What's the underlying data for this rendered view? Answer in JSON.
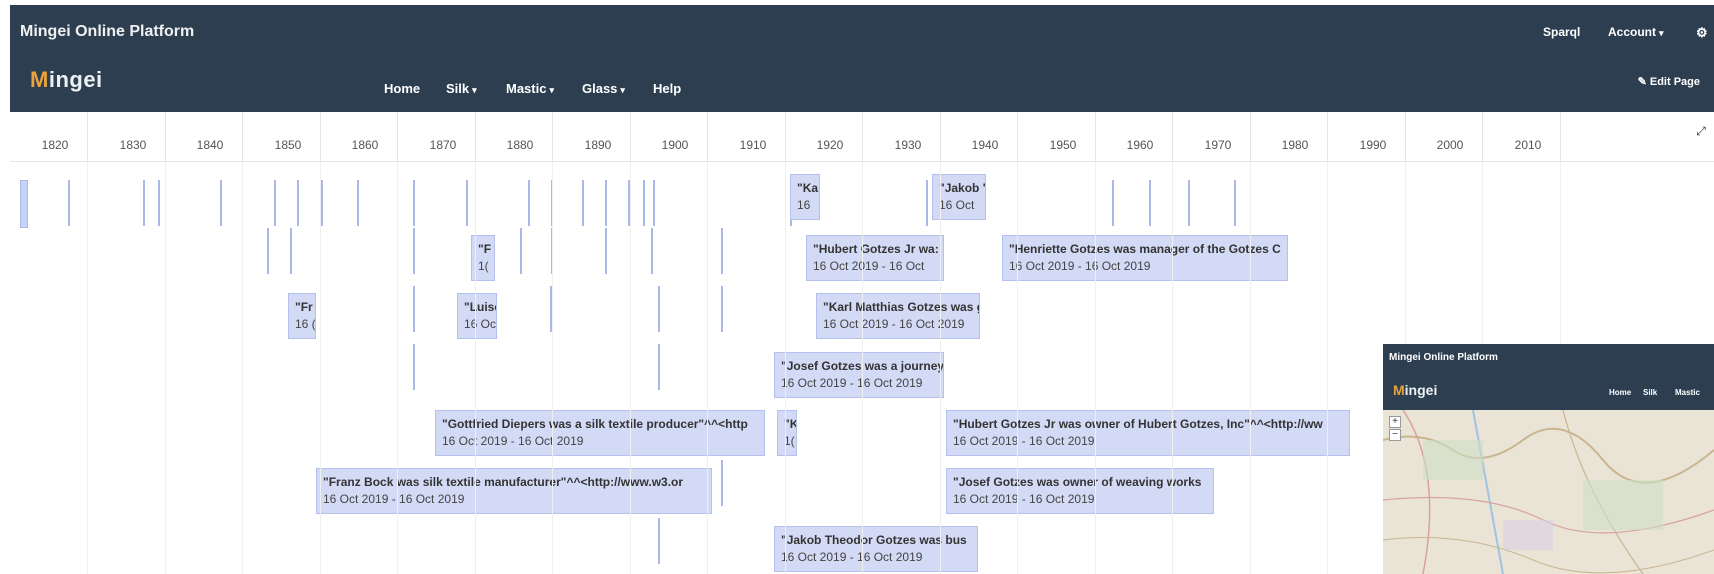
{
  "header": {
    "title": "Mingei Online Platform",
    "logo_initial": "M",
    "logo_rest": "ingei",
    "sparql": "Sparql",
    "account": "Account",
    "settings_icon": "gear-icon",
    "nav": [
      {
        "label": "Home",
        "dropdown": false
      },
      {
        "label": "Silk",
        "dropdown": true
      },
      {
        "label": "Mastic",
        "dropdown": true
      },
      {
        "label": "Glass",
        "dropdown": true
      },
      {
        "label": "Help",
        "dropdown": false
      }
    ],
    "edit_page": "Edit Page",
    "edit_icon": "pencil-icon"
  },
  "timeline": {
    "years": [
      "1820",
      "1830",
      "1840",
      "1850",
      "1860",
      "1870",
      "1880",
      "1890",
      "1900",
      "1910",
      "1920",
      "1930",
      "1940",
      "1950",
      "1960",
      "1970",
      "1980",
      "1990",
      "2000",
      "2010"
    ],
    "expand_icon": "expand-icon",
    "events": [
      {
        "title": "\"Ka",
        "date": "16"
      },
      {
        "title": "\"Jakob '",
        "date": "16 Oct"
      },
      {
        "title": "\"F",
        "date": "1("
      },
      {
        "title": "\"Hubert Gotzes Jr wa:",
        "date": "16 Oct 2019 - 16 Oct"
      },
      {
        "title": "\"Henriette Gotzes was manager of the Gotzes C",
        "date": "16 Oct 2019 - 16 Oct 2019"
      },
      {
        "title": "\"Fr",
        "date": "16 ("
      },
      {
        "title": "\"Luise",
        "date": "16 Oc"
      },
      {
        "title": "\"Karl Matthias Gotzes was gro",
        "date": "16 Oct 2019 - 16 Oct 2019"
      },
      {
        "title": "\"Josef Gotzes was a journey",
        "date": "16 Oct 2019 - 16 Oct 2019"
      },
      {
        "title": "\"Gottfried Diepers was a silk textile producer\"^^<http",
        "date": "16 Oct 2019 - 16 Oct 2019"
      },
      {
        "title": "\"K",
        "date": "1("
      },
      {
        "title": "\"Hubert Gotzes Jr was owner of Hubert Gotzes, Inc\"^^<http://ww",
        "date": "16 Oct 2019 - 16 Oct 2019"
      },
      {
        "title": "\"Franz Bock was silk textile manufacturer\"^^<http://www.w3.or",
        "date": "16 Oct 2019 - 16 Oct 2019"
      },
      {
        "title": "\"Josef Gotzes was owner of weaving works",
        "date": "16 Oct 2019 - 16 Oct 2019"
      },
      {
        "title": "\"Jakob Theodor Gotzes was bus",
        "date": "16 Oct 2019 - 16 Oct 2019"
      }
    ]
  },
  "map_window": {
    "title": "Mingei Online Platform",
    "logo_initial": "M",
    "logo_rest": "ingei",
    "nav": [
      "Home",
      "Silk",
      "Mastic"
    ],
    "zoom_in": "+",
    "zoom_out": "−"
  }
}
